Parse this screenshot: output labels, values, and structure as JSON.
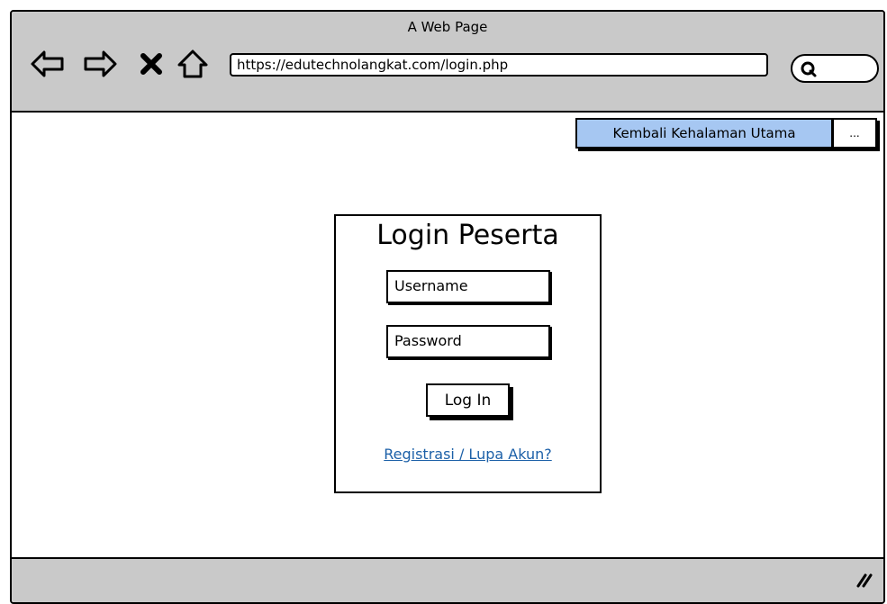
{
  "window": {
    "title": "A Web Page"
  },
  "toolbar": {
    "back_icon": "back-arrow-icon",
    "forward_icon": "forward-arrow-icon",
    "stop_icon": "close-icon",
    "home_icon": "home-icon",
    "url": "https://edutechnolangkat.com/login.php",
    "search_icon": "search-icon"
  },
  "header": {
    "home_button_label": "Kembali Kehalaman Utama",
    "more_button_label": "..."
  },
  "login": {
    "title": "Login Peserta",
    "username_value": "Username",
    "password_value": "Password",
    "login_button_label": "Log In",
    "register_link_label": "Registrasi / Lupa Akun?"
  },
  "colors": {
    "chrome_gray": "#c9c9c9",
    "button_blue": "#a6c7f2",
    "link_blue": "#1c60a8"
  }
}
